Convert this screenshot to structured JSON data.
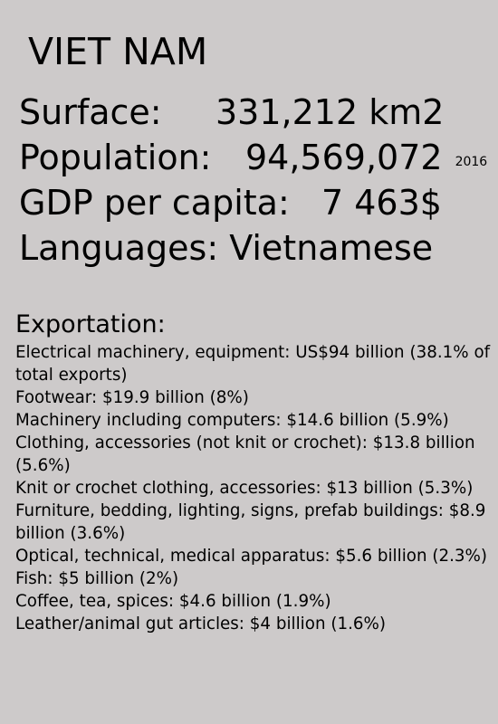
{
  "country_name": "VIET NAM",
  "facts": {
    "surface": {
      "label": "Surface:",
      "value": "331,212 km2"
    },
    "population": {
      "label": "Population:",
      "value": "94,569,072",
      "year": "2016"
    },
    "gdp": {
      "label": "GDP per capita:",
      "value": "7 463$"
    },
    "languages": {
      "text": "Languages: Vietnamese"
    }
  },
  "exportation": {
    "title": "Exportation:",
    "items": [
      "Electrical machinery, equipment: US$94 billion (38.1% of total exports)",
      "Footwear: $19.9 billion (8%)",
      "Machinery including computers: $14.6 billion (5.9%)",
      "Clothing, accessories (not knit or crochet): $13.8 billion (5.6%)",
      "Knit or crochet clothing, accessories: $13 billion (5.3%)",
      "Furniture, bedding, lighting, signs, prefab buildings: $8.9 billion (3.6%)",
      "Optical, technical, medical apparatus: $5.6 billion (2.3%)",
      "Fish: $5 billion (2%)",
      "Coffee, tea, spices: $4.6 billion (1.9%)",
      "Leather/animal gut articles: $4 billion (1.6%)"
    ]
  },
  "colors": {
    "background": "#cdcaca",
    "text": "#000000"
  }
}
